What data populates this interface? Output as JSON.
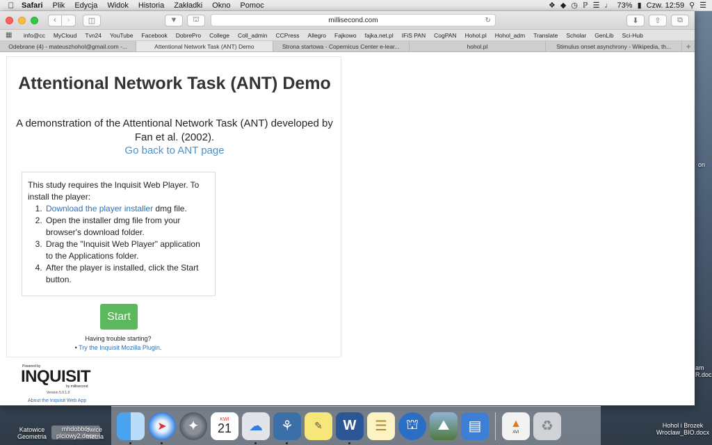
{
  "menubar": {
    "app": "Safari",
    "items": [
      "Plik",
      "Edycja",
      "Widok",
      "Historia",
      "Zakładki",
      "Okno",
      "Pomoc"
    ],
    "battery": "73%",
    "clock": "Czw. 12:59"
  },
  "browser": {
    "url": "millisecond.com",
    "bookmarks": [
      "info@cc",
      "MyCloud",
      "Tvn24",
      "YouTube",
      "Facebook",
      "DobrePro",
      "College",
      "Coll_admin",
      "CCPress",
      "Allegro",
      "Fajkowo",
      "fajka.net.pl",
      "IFiS PAN",
      "CogPAN",
      "Hohol.pl",
      "Hohol_adm",
      "Translate",
      "Scholar",
      "GenLib",
      "Sci-Hub"
    ],
    "tabs": [
      {
        "label": "Odebrane (4) - mateuszhohol@gmail.com -...",
        "active": false
      },
      {
        "label": "Attentional Network Task (ANT) Demo",
        "active": true
      },
      {
        "label": "Strona startowa - Copernicus Center e-lear...",
        "active": false
      },
      {
        "label": "hohol.pl",
        "active": false
      },
      {
        "label": "Stimulus onset asynchrony - Wikipedia, th...",
        "active": false
      }
    ],
    "new_tab": "+"
  },
  "page": {
    "title": "Attentional Network Task (ANT) Demo",
    "description_line1": "A demonstration of the Attentional Network Task (ANT) developed by",
    "description_line2": "Fan et al. (2002).",
    "back_link": "Go back to ANT page",
    "install": {
      "intro": "This study requires the Inquisit Web Player. To install the player:",
      "step1_link": "Download the player installer",
      "step1_rest": " dmg file.",
      "step2": "Open the installer dmg file from your browser's download folder.",
      "step3": "Drag the \"Inquisit Web Player\" application to the Applications folder.",
      "step4": "After the player is installed, click the Start button."
    },
    "start_label": "Start",
    "trouble_label": "Having trouble starting?",
    "trouble_bullet": "•",
    "trouble_link": "Try the Inquisit Mozilla Plugin",
    "trouble_period": ".",
    "logo": {
      "powered": "Powered by",
      "word": "INQUISIT",
      "by": "by millisecond",
      "version": "Version 5.0.1.0"
    },
    "about_link": "About the Inquisit Web App"
  },
  "desktop": {
    "left_files": [
      {
        "line1": "Katowice",
        "line2": "Geometria"
      },
      {
        "line1": "mhdobbór",
        "line2": "plciowy2.docx"
      },
      {
        "line1": "owice",
        "line2": "metria"
      }
    ],
    "right_top_file": {
      "line1": "am",
      "line2": "R.docx"
    },
    "right_side_text": "on",
    "right_file": {
      "line1": "Hohol i Brozek",
      "line2": "Wroclaw_BIO.docx"
    }
  },
  "dock": {
    "calendar_month": "KWI",
    "calendar_day": "21",
    "avi_label": "AVI"
  }
}
